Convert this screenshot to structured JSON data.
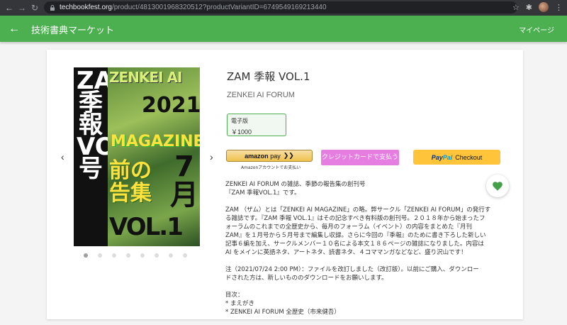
{
  "browser": {
    "url_host": "techbookfest.org",
    "url_path": "/product/4813001968320512?productVariantID=6749549169213440"
  },
  "appbar": {
    "title": "技術書典マーケット",
    "mypage_label": "マイページ"
  },
  "cover": {
    "spine": "ZAM季報VOL.1号",
    "zenkei": "ZENKEI AI",
    "year": "2021",
    "magazine": "MAGAZINE",
    "gappy": "前の告集",
    "month": "7月",
    "vol": "VOL.1号"
  },
  "product": {
    "title": "ZAM 季報 VOL.1",
    "circle": "ZENKEI AI FORUM",
    "variant_name": "電子版",
    "variant_price": "￥1000"
  },
  "payment": {
    "amazon_label": "amazon",
    "amazon_pay": "pay",
    "amazon_caption": "Amazonアカウントでお支払い",
    "credit_label": "クレジットカードで支払う",
    "paypal_label_1": "Pay",
    "paypal_label_2": "Pal",
    "paypal_checkout": "Checkout"
  },
  "description": {
    "p1_l1": "ZENKEI AI FORUM の雑誌、季節の報告集の創刊号",
    "p1_l2": "『ZAM 季報VOL.1』です。",
    "p2_l1": "ZAM （ザム）とは「ZENKEI AI MAGAZINE」の略。弊サークル「ZENKEI AI FORUM」の発行す",
    "p2_l2": "る雑誌です。『ZAM 季報 VOL.1』はその記念すべき有料版の創刊号。２０１８年から始まったフ",
    "p2_l3": "ォーラムのこれまでの全歴史から、毎月のフォーラム（イベント）の内容をまとめた『月刊",
    "p2_l4": "ZAM』を１月号から５月号まで編集し収録。さらに今回の『季報』のために書き下ろした新しい",
    "p2_l5": "記事６編を加え、サークルメンバー１０名による本文１８６ページの雑誌になりました。内容は",
    "p2_l6": "AI をメインに英語ネタ、アートネタ、読書ネタ、４コママンガなどなど、盛り沢山です！",
    "p3_l1": "注（2021/07/24 2:00 PM）：ファイルを改訂しました（改訂版）。以前にご購入、ダウンロー",
    "p3_l2": "ドされた方は、新しいもののダウンロードをお願いします。",
    "toc_title": "目次：",
    "toc_1": "* まえがき",
    "toc_2": "* ZENKEI AI FORUM 全歴史（市来健吾）"
  },
  "carousel": {
    "dot_count": 8,
    "active_index": 0
  },
  "colors": {
    "appbar": "#4caf50",
    "credit": "#e57ee0",
    "paypal": "#ffc439",
    "heart": "#43a047"
  }
}
